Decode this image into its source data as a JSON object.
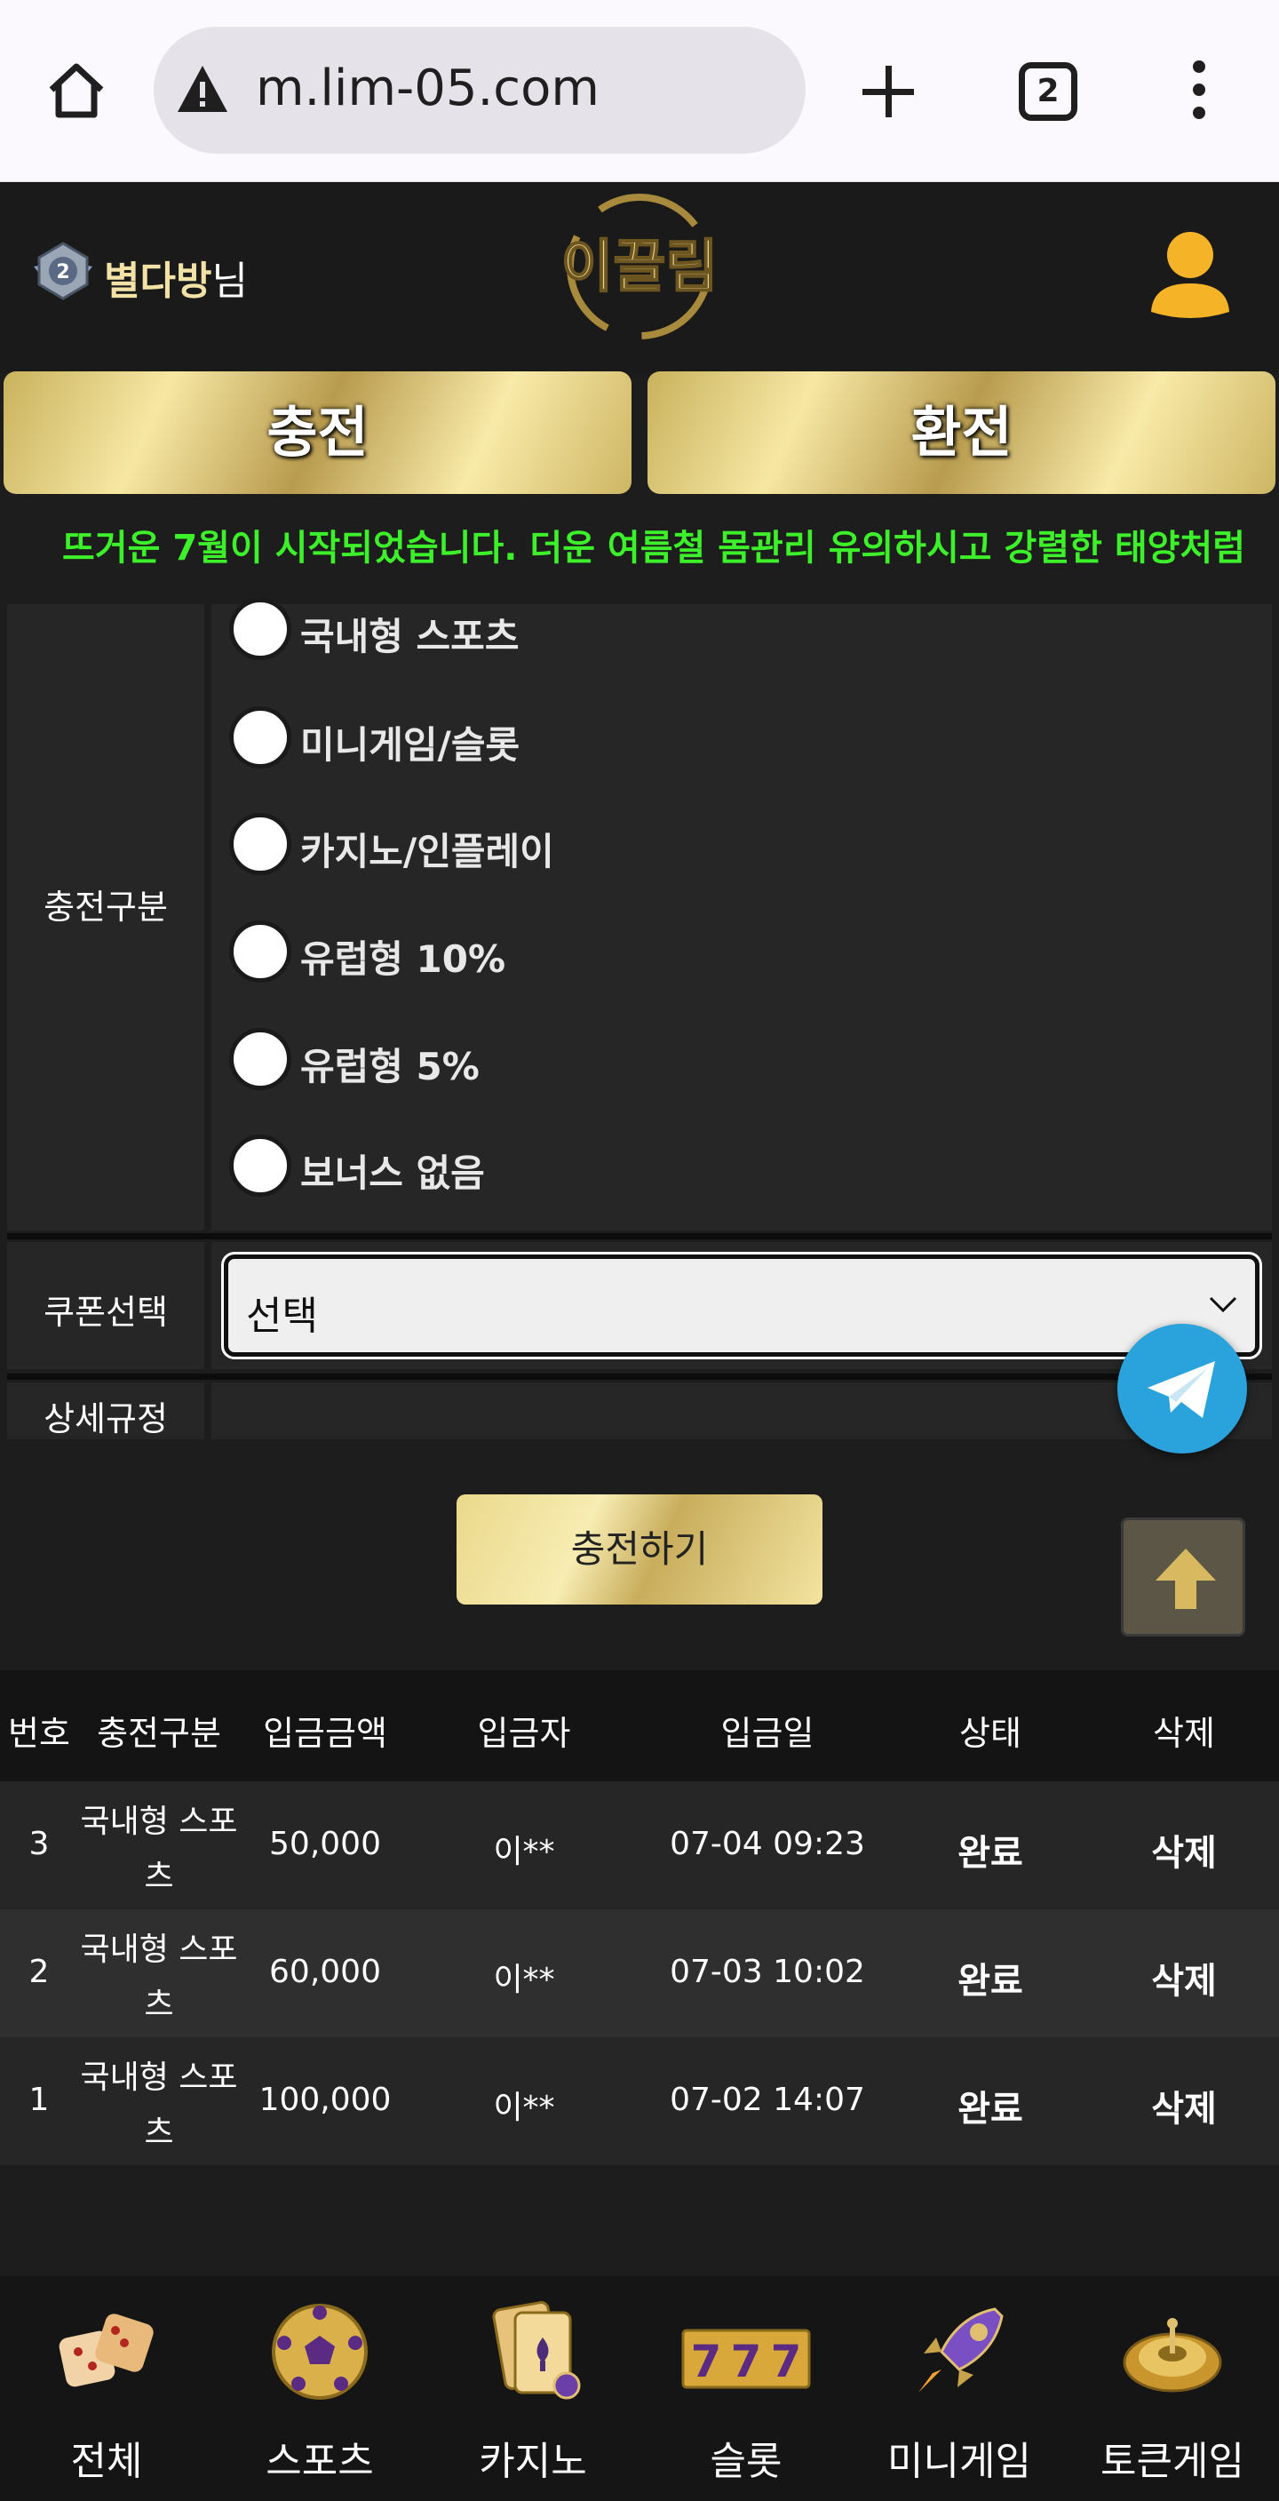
{
  "browser": {
    "url": "m.lim-05.com",
    "tab_count": "2"
  },
  "header": {
    "username": "별다방",
    "username_suffix": "님",
    "logo_text": "이끌림"
  },
  "actions": {
    "charge_label": "충전",
    "exchange_label": "환전"
  },
  "notice": "뜨거운 7월이 시작되었습니다. 더운 여름철 몸관리 유의하시고 강렬한 태양처럼",
  "form": {
    "charge_type_label": "충전구분",
    "options": [
      "국내형 스포츠",
      "미니게임/슬롯",
      "카지노/인플레이",
      "유럽형 10%",
      "유럽형 5%",
      "보너스 없음"
    ],
    "coupon_label": "쿠폰선택",
    "coupon_value": "선택",
    "rules_label": "상세규정",
    "submit_label": "충전하기"
  },
  "table": {
    "headers": [
      "번호",
      "충전구분",
      "입금금액",
      "입금자",
      "입금일",
      "상태",
      "삭제"
    ],
    "rows": [
      {
        "no": "3",
        "type1": "국내형 스포",
        "type2": "츠",
        "amount": "50,000",
        "depositor": "이**",
        "date": "07-04 09:23",
        "status": "완료",
        "delete": "삭제"
      },
      {
        "no": "2",
        "type1": "국내형 스포",
        "type2": "츠",
        "amount": "60,000",
        "depositor": "이**",
        "date": "07-03 10:02",
        "status": "완료",
        "delete": "삭제"
      },
      {
        "no": "1",
        "type1": "국내형 스포",
        "type2": "츠",
        "amount": "100,000",
        "depositor": "이**",
        "date": "07-02 14:07",
        "status": "완료",
        "delete": "삭제"
      }
    ]
  },
  "nav": [
    {
      "label": "전체",
      "icon": "dice-icon"
    },
    {
      "label": "스포츠",
      "icon": "soccer-ball-icon"
    },
    {
      "label": "카지노",
      "icon": "playing-cards-icon"
    },
    {
      "label": "슬롯",
      "icon": "slot-777-icon"
    },
    {
      "label": "미니게임",
      "icon": "rocket-icon"
    },
    {
      "label": "토큰게임",
      "icon": "roulette-icon"
    }
  ],
  "colors": {
    "accent_gold": "#d9c27a",
    "notice_green": "#3cf02a",
    "telegram_blue": "#2aa3dd",
    "background": "#1d1d1d"
  }
}
